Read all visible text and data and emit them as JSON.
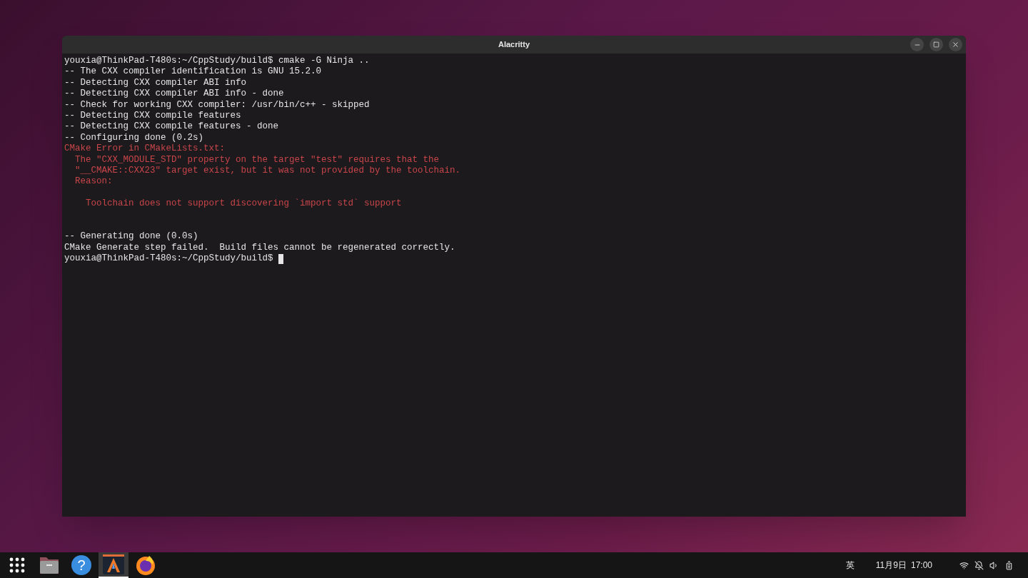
{
  "window": {
    "title": "Alacritty"
  },
  "terminal": {
    "lines": [
      {
        "kind": "normal",
        "text": "youxia@ThinkPad-T480s:~/CppStudy/build$ cmake -G Ninja .."
      },
      {
        "kind": "normal",
        "text": "-- The CXX compiler identification is GNU 15.2.0"
      },
      {
        "kind": "normal",
        "text": "-- Detecting CXX compiler ABI info"
      },
      {
        "kind": "normal",
        "text": "-- Detecting CXX compiler ABI info - done"
      },
      {
        "kind": "normal",
        "text": "-- Check for working CXX compiler: /usr/bin/c++ - skipped"
      },
      {
        "kind": "normal",
        "text": "-- Detecting CXX compile features"
      },
      {
        "kind": "normal",
        "text": "-- Detecting CXX compile features - done"
      },
      {
        "kind": "normal",
        "text": "-- Configuring done (0.2s)"
      },
      {
        "kind": "error",
        "text": "CMake Error in CMakeLists.txt:"
      },
      {
        "kind": "error",
        "text": "  The \"CXX_MODULE_STD\" property on the target \"test\" requires that the"
      },
      {
        "kind": "error",
        "text": "  \"__CMAKE::CXX23\" target exist, but it was not provided by the toolchain."
      },
      {
        "kind": "error",
        "text": "  Reason:"
      },
      {
        "kind": "blank"
      },
      {
        "kind": "error",
        "text": "    Toolchain does not support discovering `import std` support"
      },
      {
        "kind": "blank"
      },
      {
        "kind": "blank"
      },
      {
        "kind": "normal",
        "text": "-- Generating done (0.0s)"
      },
      {
        "kind": "normal",
        "text": "CMake Generate step failed.  Build files cannot be regenerated correctly."
      },
      {
        "kind": "prompt",
        "text": "youxia@ThinkPad-T480s:~/CppStudy/build$ "
      }
    ]
  },
  "taskbar": {
    "apps": [
      {
        "kind": "grid",
        "selected": false
      },
      {
        "kind": "files",
        "selected": false
      },
      {
        "kind": "help",
        "selected": false,
        "text": "?"
      },
      {
        "kind": "terminal",
        "selected": true
      },
      {
        "kind": "browser",
        "selected": false
      }
    ],
    "input_method": "英",
    "date": "11月9日",
    "time": "17:00"
  }
}
